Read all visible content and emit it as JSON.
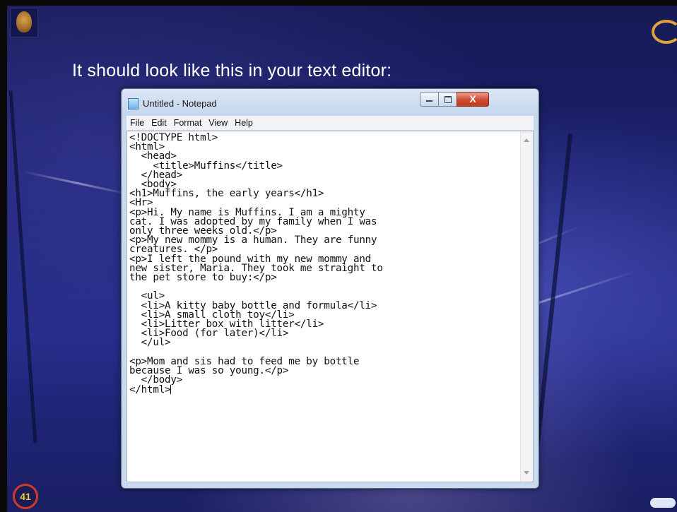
{
  "slide": {
    "heading": "It should look like this in your text editor:"
  },
  "window": {
    "title": "Untitled - Notepad",
    "menu": [
      "File",
      "Edit",
      "Format",
      "View",
      "Help"
    ],
    "close_glyph": "X"
  },
  "editor": {
    "lines": [
      "<!DOCTYPE html>",
      "<html>",
      "  <head>",
      "    <title>Muffins</title>",
      "  </head>",
      "  <body>",
      "<h1>Muffins, the early years</h1>",
      "<Hr>",
      "<p>Hi. My name is Muffins. I am a mighty",
      "cat. I was adopted by my family when I was",
      "only three weeks old.</p>",
      "<p>My new mommy is a human. They are funny",
      "creatures. </p>",
      "<p>I left the pound with my new mommy and",
      "new sister, Maria. They took me straight to",
      "the pet store to buy:</p>",
      "",
      "  <ul>",
      "  <li>A kitty baby bottle and formula</li>",
      "  <li>A small cloth toy</li>",
      "  <li>Litter box with litter</li>",
      "  <li>Food (for later)</li>",
      "  </ul>",
      "",
      "<p>Mom and sis had to feed me by bottle",
      "because I was so young.</p>",
      "  </body>",
      "</html>"
    ]
  },
  "icons": {
    "top_left": "mascot-face-icon",
    "top_right": "crescent-logo-icon",
    "bottom_left": "nav-logo-icon",
    "bottom_right": "publisher-badge-icon"
  },
  "colors": {
    "background": "#1f2678",
    "window_frame": "#c9d9ee",
    "close_button": "#c94430"
  }
}
